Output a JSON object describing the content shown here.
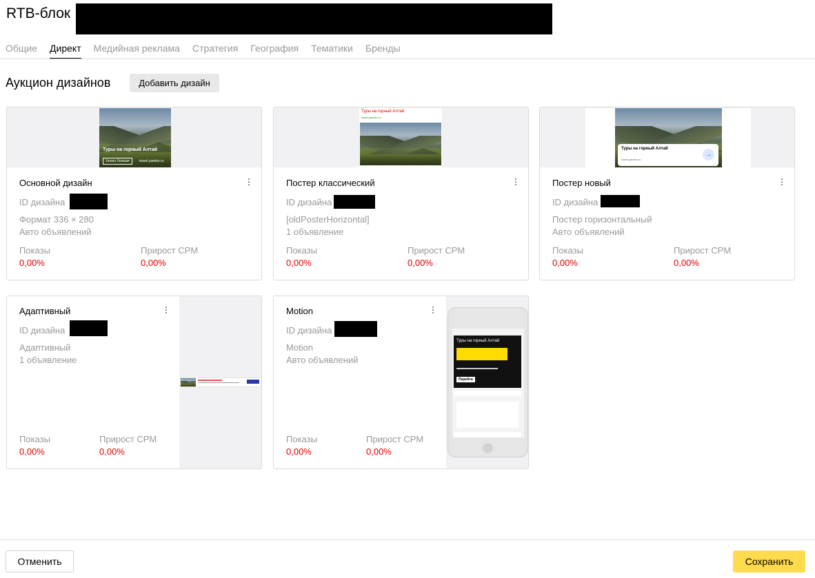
{
  "header": {
    "title": "RTB-блок"
  },
  "tabs": [
    {
      "label": "Общие",
      "active": false
    },
    {
      "label": "Директ",
      "active": true
    },
    {
      "label": "Медийная реклама",
      "active": false
    },
    {
      "label": "Стратегия",
      "active": false
    },
    {
      "label": "География",
      "active": false
    },
    {
      "label": "Тематики",
      "active": false
    },
    {
      "label": "Бренды",
      "active": false
    }
  ],
  "section": {
    "title": "Аукцион дизайнов",
    "add_button": "Добавить дизайн"
  },
  "common": {
    "id_label": "ID дизайна",
    "impressions_label": "Показы",
    "cpm_label": "Прирост CPM"
  },
  "cards": [
    {
      "name": "Основной дизайн",
      "meta1": "Формат 336 × 280",
      "meta2": "Авто объявлений",
      "impressions": "0,00%",
      "cpm": "0,00%",
      "thumb_title": "Туры на горный Алтай",
      "thumb_button": "Узнать больше",
      "thumb_url": "travel.yandex.ru"
    },
    {
      "name": "Постер классический",
      "meta1": "[oldPosterHorizontal]",
      "meta2": "1 объявление",
      "impressions": "0,00%",
      "cpm": "0,00%",
      "thumb_title": "Туры на горный Алтай",
      "thumb_url": "travel.yandex.ru"
    },
    {
      "name": "Постер новый",
      "meta1": "Постер горизонтальный",
      "meta2": "Авто объявлений",
      "impressions": "0,00%",
      "cpm": "0,00%",
      "thumb_title": "Туры на горный Алтай",
      "thumb_url": "travel.yandex.ru"
    },
    {
      "name": "Адаптивный",
      "meta1": "Адаптивный",
      "meta2": "1 объявление",
      "impressions": "0,00%",
      "cpm": "0,00%"
    },
    {
      "name": "Motion",
      "meta1": "Motion",
      "meta2": "Авто объявлений",
      "impressions": "0,00%",
      "cpm": "0,00%",
      "thumb_title": "Туры на горный Алтай",
      "thumb_button": "Перейти"
    }
  ],
  "footer": {
    "cancel": "Отменить",
    "save": "Сохранить"
  },
  "colors": {
    "accent_yellow": "#ffdb4d",
    "stat_red": "#e00000",
    "muted_text": "#999999"
  }
}
